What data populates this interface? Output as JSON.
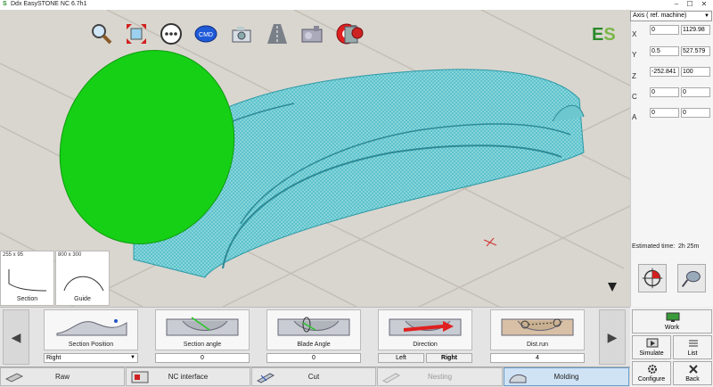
{
  "window": {
    "title": "Ddx EasySTONE NC 6.7h1",
    "controls": [
      "–",
      "☐",
      "✕"
    ]
  },
  "toolbar": {
    "icons": [
      "zoom-icon",
      "fit-view-icon",
      "more-icon",
      "cmd-icon",
      "camera-icon",
      "road-icon",
      "machine-icon",
      "fire-icon",
      "robot-icon"
    ],
    "cmd_label": "CMD",
    "logo": "ES"
  },
  "thumbnails": [
    {
      "dim": "255 x 95",
      "label": "Section"
    },
    {
      "dim": "800 x 300",
      "label": "Guide"
    }
  ],
  "axis_panel": {
    "mode": "Axis ( ref. machine)",
    "axes": [
      {
        "name": "X",
        "v1": "0",
        "v2": "1129.98"
      },
      {
        "name": "Y",
        "v1": "0.5",
        "v2": "527.579"
      },
      {
        "name": "Z",
        "v1": "-252.841",
        "v2": "100"
      },
      {
        "name": "C",
        "v1": "0",
        "v2": "0"
      },
      {
        "name": "A",
        "v1": "0",
        "v2": "0"
      }
    ],
    "estimated_label": "Estimated time:",
    "estimated_value": "2h 25m"
  },
  "operations": [
    {
      "label": "Section Position",
      "value": "Right"
    },
    {
      "label": "Section angle",
      "value": "0"
    },
    {
      "label": "Blade Angle",
      "value": "0"
    },
    {
      "label": "Direction",
      "left": "Left",
      "right": "Right"
    },
    {
      "label": "Dist.run",
      "value": "4"
    }
  ],
  "right_buttons": {
    "work": "Work",
    "simulate": "Simulate",
    "list": "List",
    "configure": "Configure",
    "back": "Back"
  },
  "tabs": [
    {
      "label": "Raw"
    },
    {
      "label": "NC interface"
    },
    {
      "label": "Cut"
    },
    {
      "label": "Nesting"
    },
    {
      "label": "Molding"
    }
  ],
  "colors": {
    "mesh": "#3fb8c4",
    "disc": "#16d016",
    "active_tab": "#cfe3f5",
    "logo": "#2a8a2a"
  }
}
